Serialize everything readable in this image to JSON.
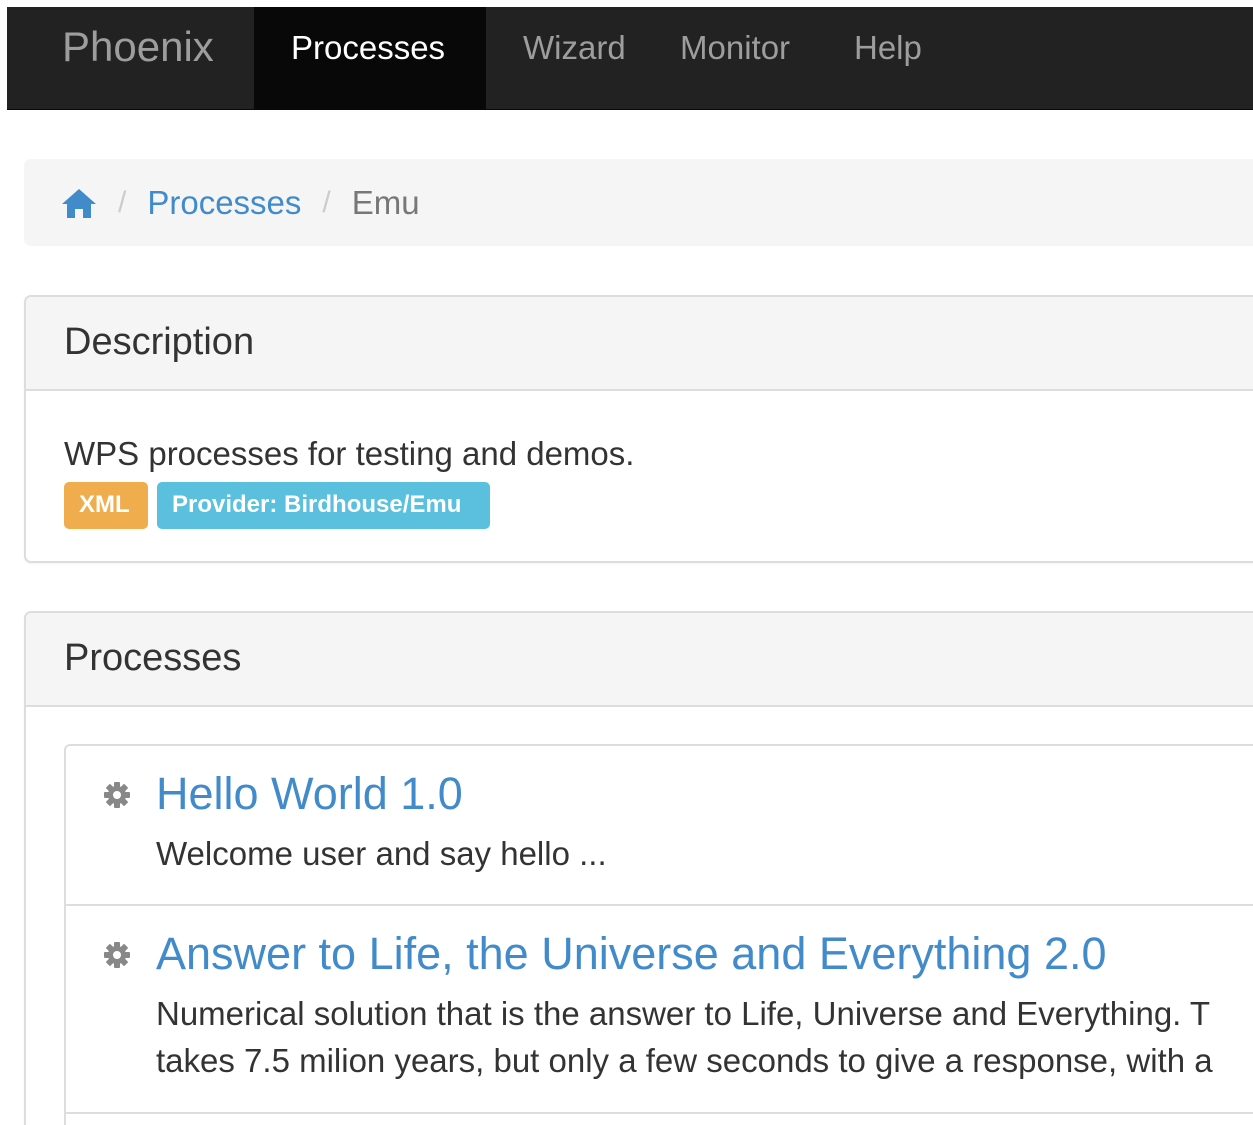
{
  "navbar": {
    "brand": "Phoenix",
    "items": [
      {
        "label": "Processes",
        "active": true
      },
      {
        "label": "Wizard",
        "active": false
      },
      {
        "label": "Monitor",
        "active": false
      },
      {
        "label": "Help",
        "active": false
      }
    ]
  },
  "breadcrumb": {
    "home_icon": "home-icon",
    "separator": "/",
    "items": [
      {
        "label": "Processes",
        "link": true
      },
      {
        "label": "Emu",
        "link": false
      }
    ]
  },
  "description_panel": {
    "heading": "Description",
    "text": "WPS processes for testing and demos.",
    "labels": [
      {
        "text": "XML",
        "color": "#f0ad4e"
      },
      {
        "text": "Provider: Birdhouse/Emu",
        "color": "#5bc0de"
      }
    ]
  },
  "processes_panel": {
    "heading": "Processes",
    "items": [
      {
        "icon": "gear-icon",
        "title": "Hello World 1.0",
        "description_lines": [
          "Welcome user and say hello ..."
        ]
      },
      {
        "icon": "gear-icon",
        "title": "Answer to Life, the Universe and Everything 2.0",
        "description_lines": [
          "Numerical solution that is the answer to Life, Universe and Everything. T",
          "takes 7.5 milion years, but only a few seconds to give a response, with a"
        ]
      }
    ]
  },
  "colors": {
    "navbar_bg": "#222222",
    "navbar_active_bg": "#080808",
    "link": "#428bca",
    "label_warning": "#f0ad4e",
    "label_info": "#5bc0de"
  }
}
